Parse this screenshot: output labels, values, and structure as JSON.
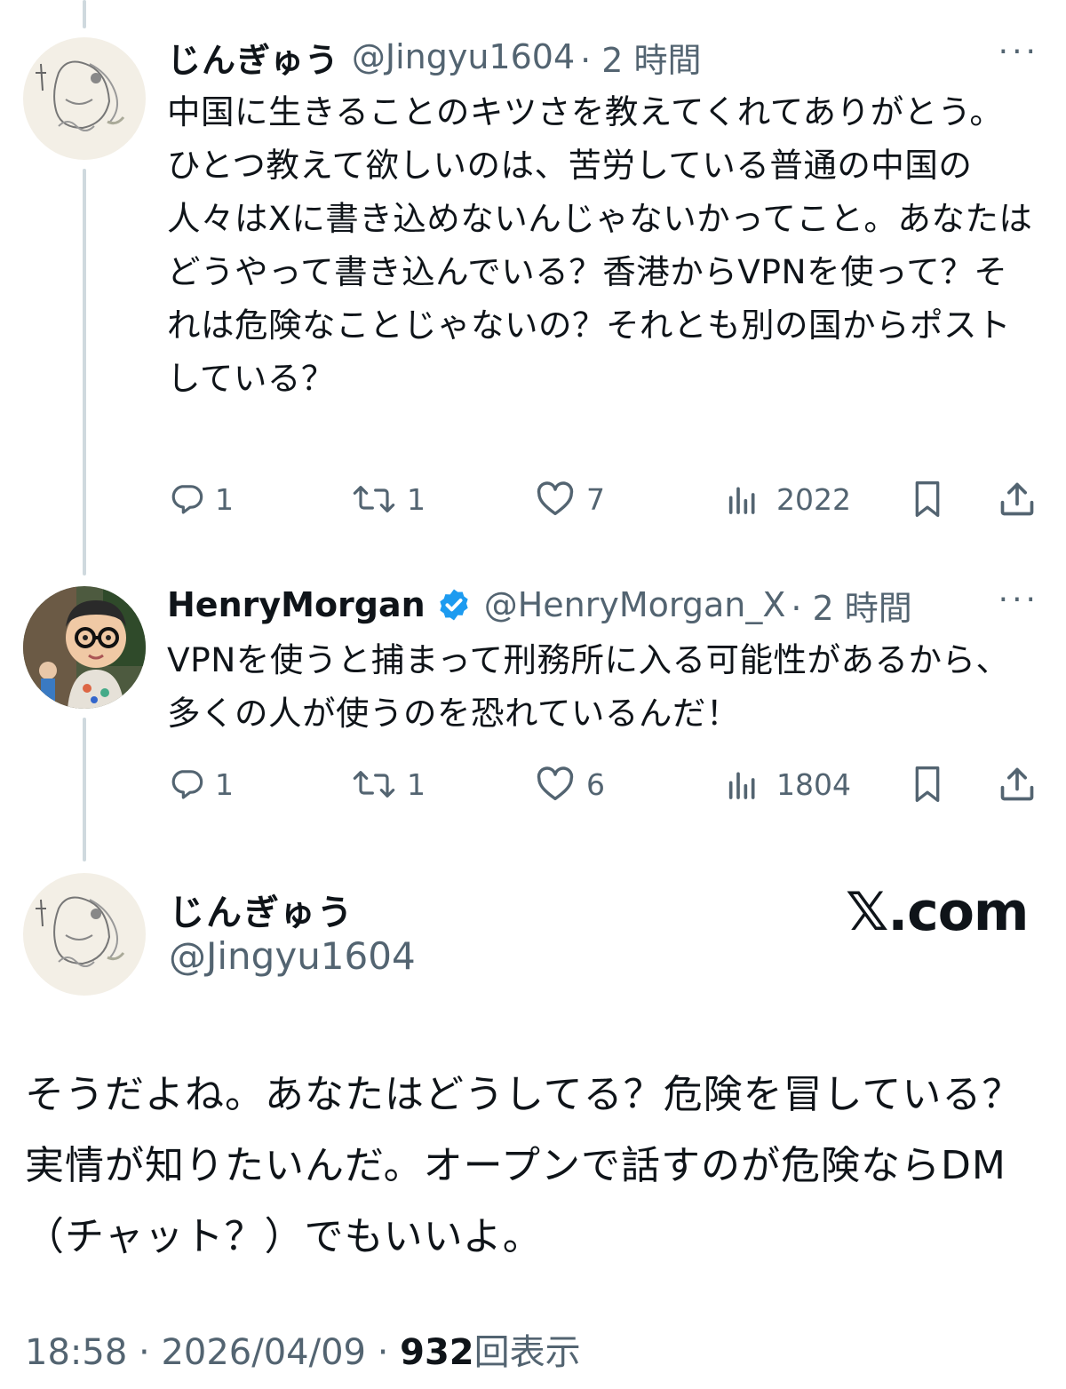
{
  "thread": [
    {
      "display_name": "じんぎゅう",
      "handle": "@Jingyu1604",
      "time": "· 2 時間",
      "more": "···",
      "body": "中国に生きることのキツさを教えてくれてありがとう。\nひとつ教えて欲しいのは、苦労している普通の中国の人々はXに書き込めないんじゃないかってこと。あなたはどうやって書き込んでいる？香港からVPNを使って？それは危険なことじゃないの？それとも別の国からポストしている？",
      "replies": "1",
      "reposts": "1",
      "likes": "7",
      "views": "2022",
      "verified": false
    },
    {
      "display_name": "HenryMorgan",
      "handle": "@HenryMorgan_X",
      "time": "· 2 時間",
      "more": "···",
      "body": "VPNを使うと捕まって刑務所に入る可能性があるから、多くの人が使うのを恐れているんだ！",
      "replies": "1",
      "reposts": "1",
      "likes": "6",
      "views": "1804",
      "verified": true
    }
  ],
  "main_tweet": {
    "display_name": "じんぎゅう",
    "handle": "@Jingyu1604",
    "brand": "𝕏.com",
    "body": "そうだよね。あなたはどうしてる？危険を冒している？実情が知りたいんだ。オープンで話すのが危険ならDM（チャット？）でもいいよ。",
    "time": "18:58",
    "date": "2026/04/09",
    "sep": "·",
    "view_count": "932",
    "view_label": "回表示"
  },
  "colors": {
    "text": "#0f1419",
    "secondary": "#536471",
    "verified_blue": "#1d9bf0",
    "thread_line": "#cfd9de"
  },
  "icons": [
    "reply-icon",
    "repost-icon",
    "like-icon",
    "views-icon",
    "bookmark-icon",
    "share-icon",
    "verified-badge-icon",
    "more-icon"
  ]
}
